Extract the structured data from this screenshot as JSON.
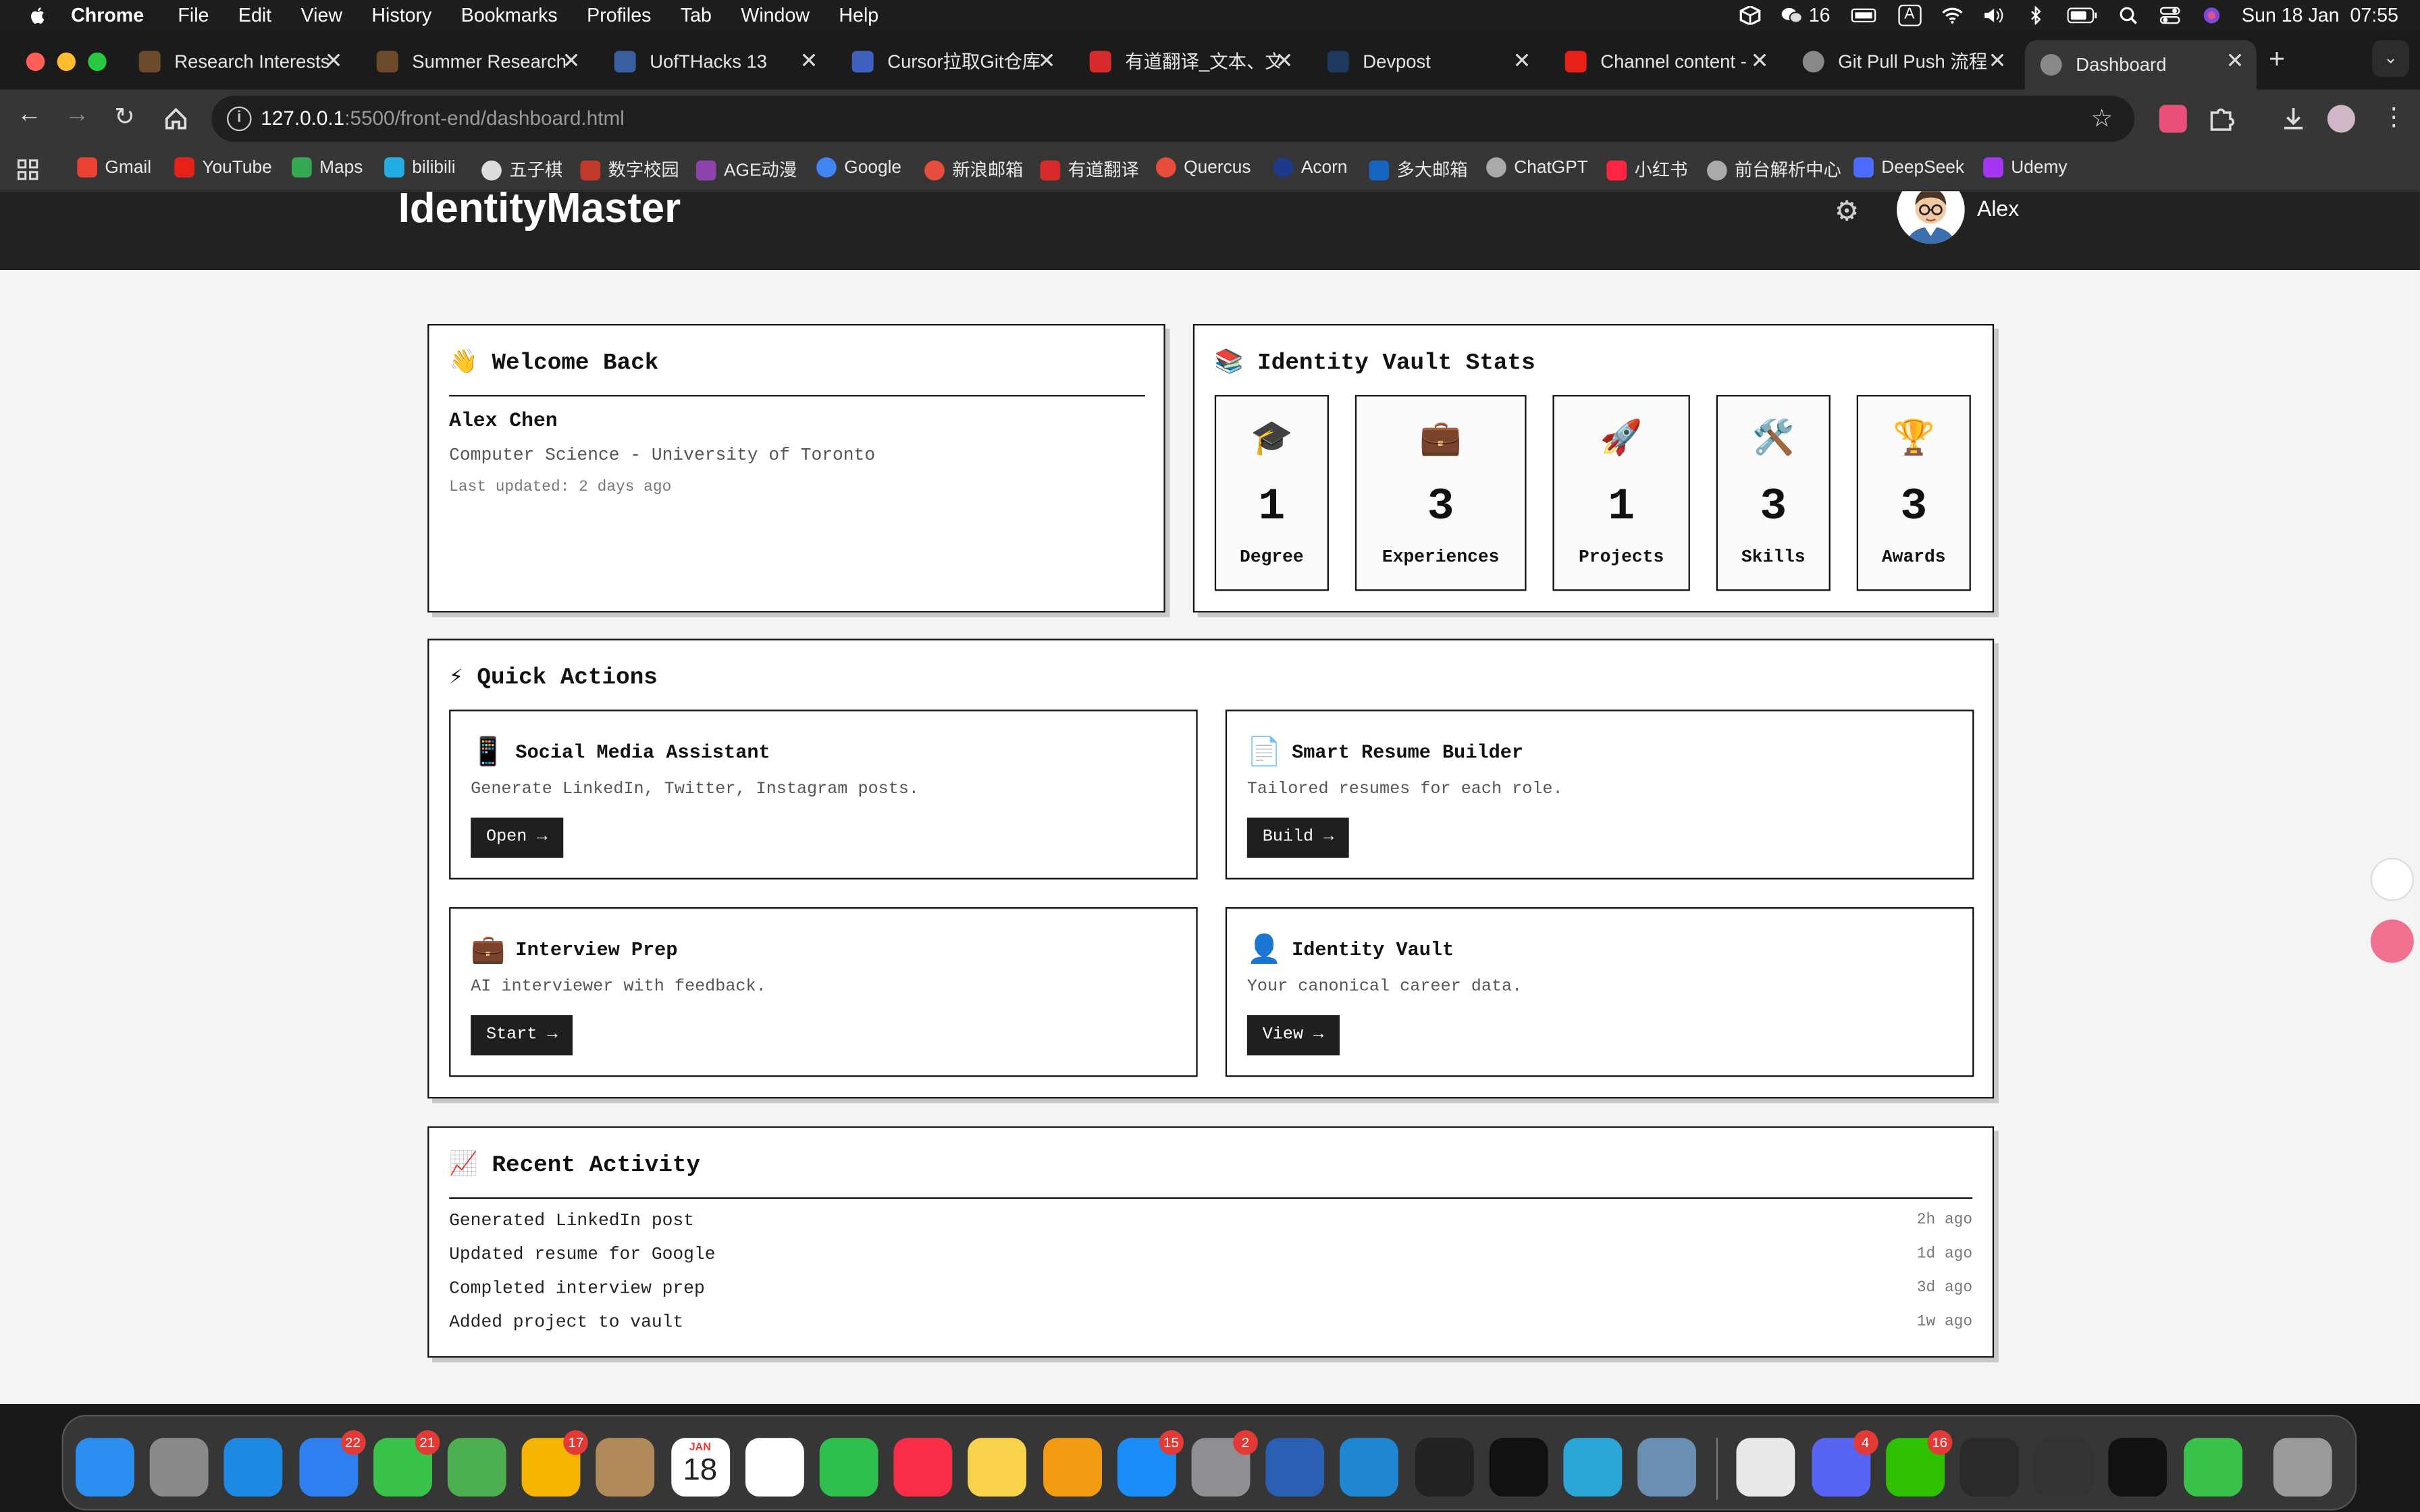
{
  "menubar": {
    "app": "Chrome",
    "items": [
      "File",
      "Edit",
      "View",
      "History",
      "Bookmarks",
      "Profiles",
      "Tab",
      "Window",
      "Help"
    ],
    "wechat_count": "16",
    "input_badge": "A",
    "clock": "Sun 18 Jan  07:55"
  },
  "tabs": [
    {
      "title": "Research Interests",
      "color": "#6b4a2b"
    },
    {
      "title": "Summer Research",
      "color": "#6b4a2b"
    },
    {
      "title": "UofTHacks 13",
      "color": "#3a5fa0"
    },
    {
      "title": "Cursor拉取Git仓库",
      "color": "#4060c0"
    },
    {
      "title": "有道翻译_文本、文",
      "color": "#d92b2b"
    },
    {
      "title": "Devpost",
      "color": "#1e3a5f"
    },
    {
      "title": "Channel content -",
      "color": "#e62117"
    },
    {
      "title": "Git Pull Push 流程",
      "color": "#888888"
    },
    {
      "title": "Dashboard",
      "color": "#888888"
    }
  ],
  "address": {
    "host": "127.0.0.1",
    "rest": ":5500/front-end/dashboard.html"
  },
  "bookmarks": [
    {
      "label": "Gmail",
      "color": "#ea4335"
    },
    {
      "label": "YouTube",
      "color": "#e62117"
    },
    {
      "label": "Maps",
      "color": "#34a853"
    },
    {
      "label": "bilibili",
      "color": "#23ade5"
    },
    {
      "label": "五子棋",
      "color": "#dddddd"
    },
    {
      "label": "数字校园",
      "color": "#c0392b"
    },
    {
      "label": "AGE动漫",
      "color": "#8e44ad"
    },
    {
      "label": "Google",
      "color": "#4285f4"
    },
    {
      "label": "新浪邮箱",
      "color": "#e74c3c"
    },
    {
      "label": "有道翻译",
      "color": "#d92b2b"
    },
    {
      "label": "Quercus",
      "color": "#e74c3c"
    },
    {
      "label": "Acorn",
      "color": "#1e3a8a"
    },
    {
      "label": "多大邮箱",
      "color": "#1565c0"
    },
    {
      "label": "ChatGPT",
      "color": "#aaaaaa"
    },
    {
      "label": "小红书",
      "color": "#ff2442"
    },
    {
      "label": "前台解析中心",
      "color": "#aaaaaa"
    },
    {
      "label": "DeepSeek",
      "color": "#4d6bfe"
    },
    {
      "label": "Udemy",
      "color": "#a435f0"
    }
  ],
  "app": {
    "brand": "IdentityMaster",
    "user": "Alex",
    "welcome": {
      "icon": "👋",
      "title": "Welcome Back",
      "name": "Alex Chen",
      "subtitle": "Computer Science - University of Toronto",
      "updated": "Last updated: 2 days ago"
    },
    "stats": {
      "icon": "📚",
      "title": "Identity Vault Stats",
      "items": [
        {
          "icon": "🎓",
          "value": "1",
          "label": "Degree"
        },
        {
          "icon": "💼",
          "value": "3",
          "label": "Experiences"
        },
        {
          "icon": "🚀",
          "value": "1",
          "label": "Projects"
        },
        {
          "icon": "🛠️",
          "value": "3",
          "label": "Skills"
        },
        {
          "icon": "🏆",
          "value": "3",
          "label": "Awards"
        }
      ]
    },
    "quick_actions": {
      "icon": "⚡",
      "title": "Quick Actions",
      "items": [
        {
          "icon": "📱",
          "title": "Social Media Assistant",
          "desc": "Generate LinkedIn, Twitter, Instagram posts.",
          "button": "Open →"
        },
        {
          "icon": "📄",
          "title": "Smart Resume Builder",
          "desc": "Tailored resumes for each role.",
          "button": "Build →"
        },
        {
          "icon": "💼",
          "title": "Interview Prep",
          "desc": "AI interviewer with feedback.",
          "button": "Start →"
        },
        {
          "icon": "👤",
          "title": "Identity Vault",
          "desc": "Your canonical career data.",
          "button": "View →"
        }
      ]
    },
    "recent": {
      "icon": "📈",
      "title": "Recent Activity",
      "items": [
        {
          "text": "Generated LinkedIn post",
          "time": "2h ago"
        },
        {
          "text": "Updated resume for Google",
          "time": "1d ago"
        },
        {
          "text": "Completed interview prep",
          "time": "3d ago"
        },
        {
          "text": "Added project to vault",
          "time": "1w ago"
        }
      ]
    }
  },
  "dock": {
    "apps": [
      {
        "name": "finder",
        "color": "#2b8ef0",
        "badge": ""
      },
      {
        "name": "launchpad",
        "color": "#8a8a8a",
        "badge": ""
      },
      {
        "name": "safari",
        "color": "#1e88e5",
        "badge": ""
      },
      {
        "name": "mail",
        "color": "#2f7ff0",
        "badge": "22"
      },
      {
        "name": "messages",
        "color": "#3ac34a",
        "badge": "21"
      },
      {
        "name": "maps",
        "color": "#4caf50",
        "badge": ""
      },
      {
        "name": "photos",
        "color": "#f4b400",
        "badge": "17"
      },
      {
        "name": "contacts",
        "color": "#b08a5a",
        "badge": ""
      },
      {
        "name": "calendar",
        "color": "#ffffff",
        "badge": ""
      },
      {
        "name": "reminders",
        "color": "#ffffff",
        "badge": ""
      },
      {
        "name": "facetime",
        "color": "#2fbf4f",
        "badge": ""
      },
      {
        "name": "music",
        "color": "#fa2d48",
        "badge": ""
      },
      {
        "name": "notes",
        "color": "#f7d24a",
        "badge": ""
      },
      {
        "name": "pages",
        "color": "#f39c12",
        "badge": ""
      },
      {
        "name": "app-store",
        "color": "#1c8ef9",
        "badge": "15"
      },
      {
        "name": "system-settings",
        "color": "#8e8e93",
        "badge": "2"
      },
      {
        "name": "word",
        "color": "#2b5fb3",
        "badge": ""
      },
      {
        "name": "vscode",
        "color": "#1f86d1",
        "badge": ""
      },
      {
        "name": "activity-monitor",
        "color": "#222222",
        "badge": ""
      },
      {
        "name": "terminal",
        "color": "#111111",
        "badge": ""
      },
      {
        "name": "accessibility",
        "color": "#2aa6d8",
        "badge": ""
      },
      {
        "name": "preview",
        "color": "#6a8fb3",
        "badge": ""
      },
      {
        "name": "chrome",
        "color": "#e8e8e8",
        "badge": ""
      },
      {
        "name": "discord",
        "color": "#5865f2",
        "badge": "4"
      },
      {
        "name": "wechat",
        "color": "#2dc100",
        "badge": "16"
      },
      {
        "name": "cube-app",
        "color": "#2a2a2a",
        "badge": ""
      },
      {
        "name": "quill",
        "color": "#333333",
        "badge": ""
      },
      {
        "name": "capcut",
        "color": "#111111",
        "badge": ""
      },
      {
        "name": "messages-2",
        "color": "#3ac34a",
        "badge": ""
      },
      {
        "name": "trash",
        "color": "#9a9a9a",
        "badge": ""
      }
    ],
    "calendar_month": "JAN",
    "calendar_day": "18"
  }
}
